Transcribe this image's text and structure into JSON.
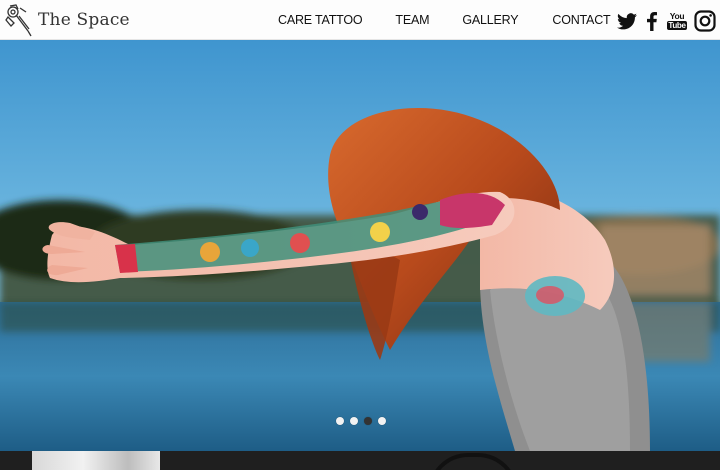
{
  "brand": {
    "name": "The Space",
    "logo_icon": "tattoo-machine-icon"
  },
  "nav": {
    "items": [
      {
        "label": "CARE TATTOO"
      },
      {
        "label": "TEAM"
      },
      {
        "label": "GALLERY"
      },
      {
        "label": "CONTACT"
      }
    ]
  },
  "social": {
    "icons": [
      "twitter-icon",
      "facebook-icon",
      "youtube-icon",
      "instagram-icon"
    ],
    "youtube_you": "You",
    "youtube_tube": "Tube"
  },
  "hero": {
    "image": "Red-haired woman with tattooed arm outstretched by a lake",
    "slides_total": 4,
    "active_slide": 3
  },
  "colors": {
    "header_bg": "#fdfdfd",
    "text": "#111111",
    "sky": "#5aa8d8",
    "water": "#1f5a82"
  }
}
